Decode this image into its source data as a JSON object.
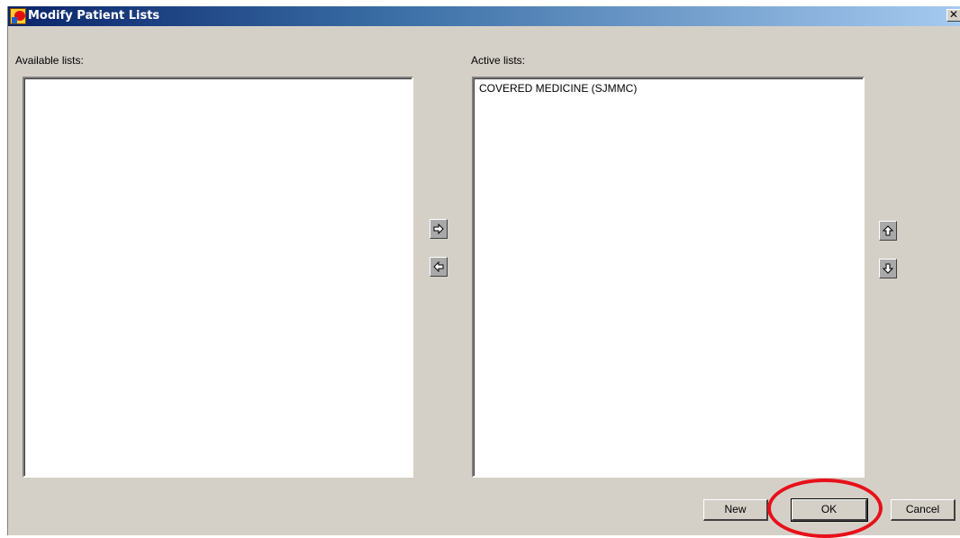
{
  "window": {
    "title": "Modify Patient Lists",
    "close_label": "✕"
  },
  "available": {
    "label": "Available lists:",
    "items": []
  },
  "active": {
    "label": "Active lists:",
    "items": [
      "COVERED MEDICINE (SJMMC)"
    ]
  },
  "buttons": {
    "new_label": "New",
    "ok_label": "OK",
    "cancel_label": "Cancel"
  },
  "icons": {
    "add": "arrow-right-icon",
    "remove": "arrow-left-icon",
    "up": "arrow-up-icon",
    "down": "arrow-down-icon"
  },
  "colors": {
    "annotation": "#e8101a",
    "title_gradient_start": "#0a246a"
  }
}
